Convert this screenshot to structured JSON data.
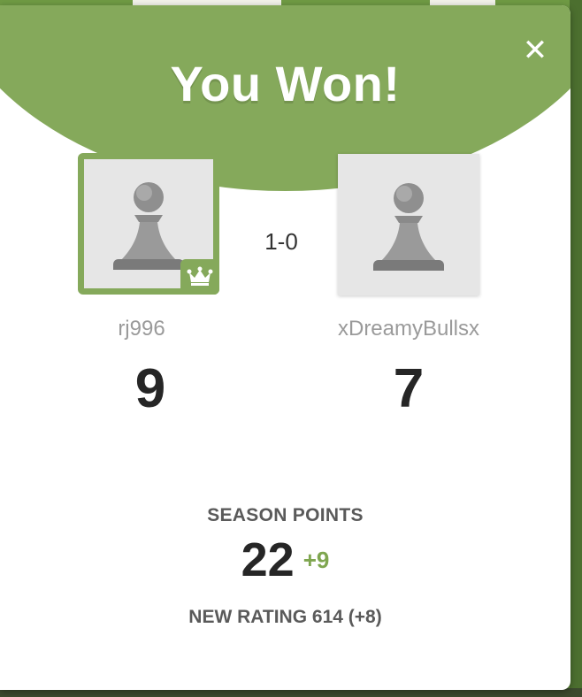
{
  "modal": {
    "title": "You Won!",
    "close_icon": "close-icon",
    "colors": {
      "header_green": "#85a95b",
      "accent_green": "#7fa650",
      "text_dark": "#262626",
      "text_muted": "#9a9a9a"
    }
  },
  "match": {
    "result": "1-0",
    "player": {
      "username": "rj996",
      "points": "9",
      "avatar_icon": "pawn-icon",
      "badge_icon": "crown-icon"
    },
    "opponent": {
      "username": "xDreamyBullsx",
      "points": "7",
      "avatar_icon": "pawn-icon"
    }
  },
  "season": {
    "label": "SEASON POINTS",
    "value": "22",
    "delta": "+9"
  },
  "rating": {
    "text": "NEW RATING 614 (+8)"
  }
}
